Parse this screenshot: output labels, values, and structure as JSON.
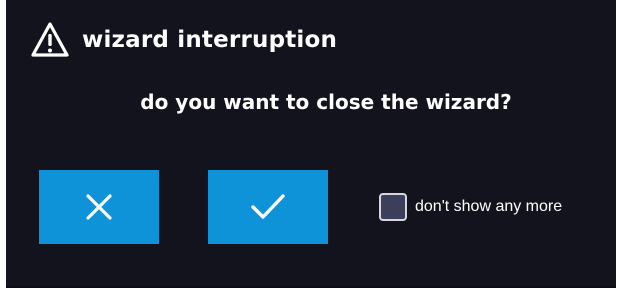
{
  "dialog": {
    "title": "wizard interruption",
    "question": "do you want to close the wizard?",
    "title_icon": "warning-triangle-icon",
    "cancel_icon": "close-icon",
    "confirm_icon": "checkmark-icon",
    "checkbox_label": "don't show any more",
    "checkbox_checked": false
  },
  "colors": {
    "background": "#13131e",
    "button": "#0f93d8",
    "text": "#ffffff",
    "checkbox_fill": "#3c3f5c"
  }
}
